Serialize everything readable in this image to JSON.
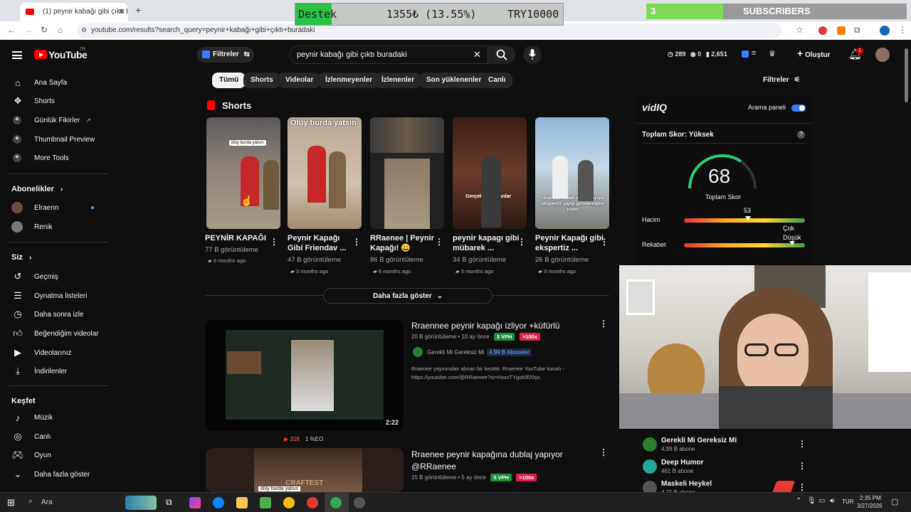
{
  "browser": {
    "tab_title": "(1) peynir kabağı gibi çıktı bura",
    "url": "youtube.com/results?search_query=peynir+kabağı+gibi+çıktı+buradaki"
  },
  "overlay": {
    "donation_label": "Destek",
    "donation_amount": "1355₺ (13.55%)",
    "donation_goal": "TRY10000",
    "donation_progress": 0.1355,
    "subs_count": "3",
    "subs_label": "SUBSCRIBERS"
  },
  "header": {
    "logo": "YouTube",
    "logo_region": "TR",
    "filter_label": "Filtreler",
    "search_value": "peynir kabağı gibi çıktı buradaki",
    "stat_1": "289",
    "stat_2": "0",
    "stat_3": "2,651",
    "create_label": "Oluştur",
    "notification_count": "1"
  },
  "sidebar": {
    "main": [
      {
        "label": "Ana Sayfa",
        "icon": "home-icon"
      },
      {
        "label": "Shorts",
        "icon": "shorts-icon"
      },
      {
        "label": "Günlük Fikirler",
        "icon": "vidiq-icon"
      },
      {
        "label": "Thumbnail Preview",
        "icon": "vidiq-icon"
      },
      {
        "label": "More Tools",
        "icon": "vidiq-icon"
      }
    ],
    "subscriptions_heading": "Abonelikler",
    "subscriptions": [
      {
        "label": "Elraenn"
      },
      {
        "label": "Renik"
      }
    ],
    "you_heading": "Siz",
    "you": [
      {
        "label": "Geçmiş"
      },
      {
        "label": "Oynatma listeleri"
      },
      {
        "label": "Daha sonra izle"
      },
      {
        "label": "Beğendiğim videolar"
      },
      {
        "label": "Videolarınız"
      },
      {
        "label": "İndirilenler"
      }
    ],
    "explore_heading": "Keşfet",
    "explore": [
      {
        "label": "Müzik"
      },
      {
        "label": "Canlı"
      },
      {
        "label": "Oyun"
      },
      {
        "label": "Daha fazla göster"
      }
    ]
  },
  "chips": [
    "Tümü",
    "Shorts",
    "Videolar",
    "İzlenmeyenler",
    "İzlenenler",
    "Son yüklenenler",
    "Canlı"
  ],
  "filters_right": "Filtreler",
  "shorts": {
    "heading": "Shorts",
    "items": [
      {
        "title": "PEYNİR KAPAĞI",
        "views": "77 B görüntüleme",
        "ago": "6 months ago",
        "overlay": "ölüy burda yatsın"
      },
      {
        "title": "Peynir Kapağı Gibi Friendav ...",
        "views": "47 B görüntüleme",
        "ago": "3 months ago",
        "overlay": "Ölüy burda yatsın"
      },
      {
        "title": "RRaenee | Peynir Kapağı! 😄",
        "views": "86 B görüntüleme",
        "ago": "6 months ago",
        "overlay": ""
      },
      {
        "title": "peynir kapagı gibi mübarek ...",
        "views": "34 B görüntüleme",
        "ago": "5 months ago",
        "overlay": "Gerçekte Romanlar"
      },
      {
        "title": "Peynir Kapağı gibi ekspertiz ...",
        "views": "26 B görüntüleme",
        "ago": "3 months ago",
        "overlay": "Arabaya kazalı diyen dayıya ekspertiz yapıp gönderdiğim video"
      }
    ],
    "show_more": "Daha fazla göster"
  },
  "videos": [
    {
      "title": "Rraennee peynir kapağı izliyor +küfürlü",
      "views": "20 B görüntüleme",
      "ago": "10 ay önce",
      "vph": "3 VPH",
      "multiplier": ">100x",
      "channel": "Gerekli Mi Gereksiz Mi",
      "subs_badge": "4,99 B Aboneler",
      "desc_1": "Rraenee yayınından alınan bir kesittir. Rraenee YouTube kanalı -",
      "desc_2": "https://youtube.com/@RRaenee?si=HxsxTYgokIlf20yc.",
      "duration": "2:22",
      "below_stat_1": "318",
      "below_stat_2": "1 %EO"
    },
    {
      "title": "Rraenee peynir kapağına dublaj yapıyor @RRaenee",
      "views": "15 B görüntüleme",
      "ago": "5 ay önce",
      "vph": "5 VPH",
      "multiplier": ">100x",
      "thumb_text_1": "CRAFTEST",
      "thumb_text_2": "ölüy burda yatsın"
    }
  ],
  "vidiq": {
    "brand": "vidIQ",
    "search_panel": "Arama paneli",
    "score_heading": "Toplam Skor: Yüksek",
    "score": "68",
    "score_label": "Toplam Skor",
    "volume_label": "Hacim",
    "volume_value": "53",
    "competition_label": "Rekabet",
    "competition_value_1": "Çok",
    "competition_value_2": "Düşük"
  },
  "channels": [
    {
      "name": "Gerekli Mi Gereksiz Mi",
      "subs": "4,99 B abone",
      "color": "#2e7d32"
    },
    {
      "name": "Deep Humor",
      "subs": "461 B abone",
      "color": "#26a69a"
    },
    {
      "name": "Maskeli Heykel",
      "subs": "4,71 B abone",
      "color": "#555555"
    }
  ],
  "taskbar": {
    "search": "Ara",
    "lang": "TUR",
    "time": "2:35 PM",
    "date": "3/27/2026"
  },
  "colors": {
    "youtube_red": "#ff0000",
    "vph_green": "#1b8f3a",
    "multiplier_red": "#e0204b",
    "vidiq_blue": "#3e7bff"
  }
}
